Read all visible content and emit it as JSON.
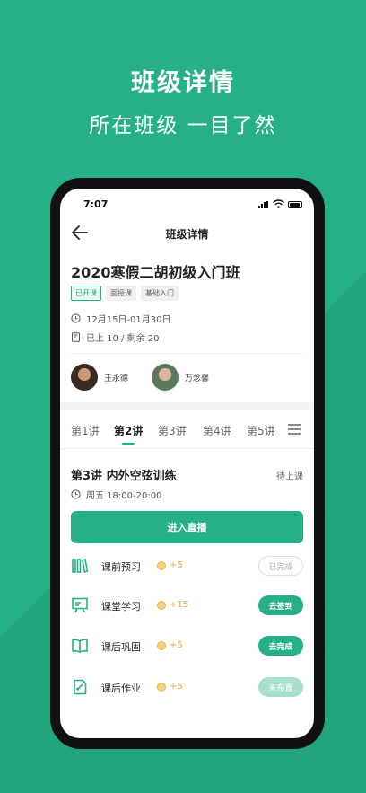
{
  "promo": {
    "title": "班级详情",
    "subtitle": "所在班级 一目了然"
  },
  "status_bar": {
    "time": "7:07"
  },
  "nav": {
    "title": "班级详情",
    "back_icon": "arrow-left-icon"
  },
  "class": {
    "title": "2020寒假二胡初级入门班",
    "tags": [
      "已开课",
      "面授课",
      "基础入门"
    ],
    "date_range": "12月15日-01月30日",
    "progress": "已上 10 / 剩余 20"
  },
  "teachers": [
    {
      "name": "王永德"
    },
    {
      "name": "万念馨"
    }
  ],
  "tabs": [
    {
      "label": "第1讲",
      "active": false
    },
    {
      "label": "第2讲",
      "active": true
    },
    {
      "label": "第3讲",
      "active": false
    },
    {
      "label": "第4讲",
      "active": false
    },
    {
      "label": "第5讲",
      "active": false
    }
  ],
  "lesson": {
    "title": "第3讲  内外空弦训练",
    "status": "待上课",
    "time": "周五 18:00-20:00",
    "live_button": "进入直播"
  },
  "tasks": [
    {
      "label": "课前预习",
      "points": "+5",
      "action": "已完成",
      "icon": "books-icon"
    },
    {
      "label": "课堂学习",
      "points": "+15",
      "action": "去签到",
      "icon": "presentation-icon"
    },
    {
      "label": "课后巩固",
      "points": "+5",
      "action": "去完成",
      "icon": "open-book-icon"
    },
    {
      "label": "课后作业",
      "points": "+5",
      "action": "未布置",
      "icon": "homework-icon"
    }
  ],
  "colors": {
    "brand_green": "#25b085",
    "coin": "#e8a93a",
    "pale_green": "#a8e0cb"
  }
}
